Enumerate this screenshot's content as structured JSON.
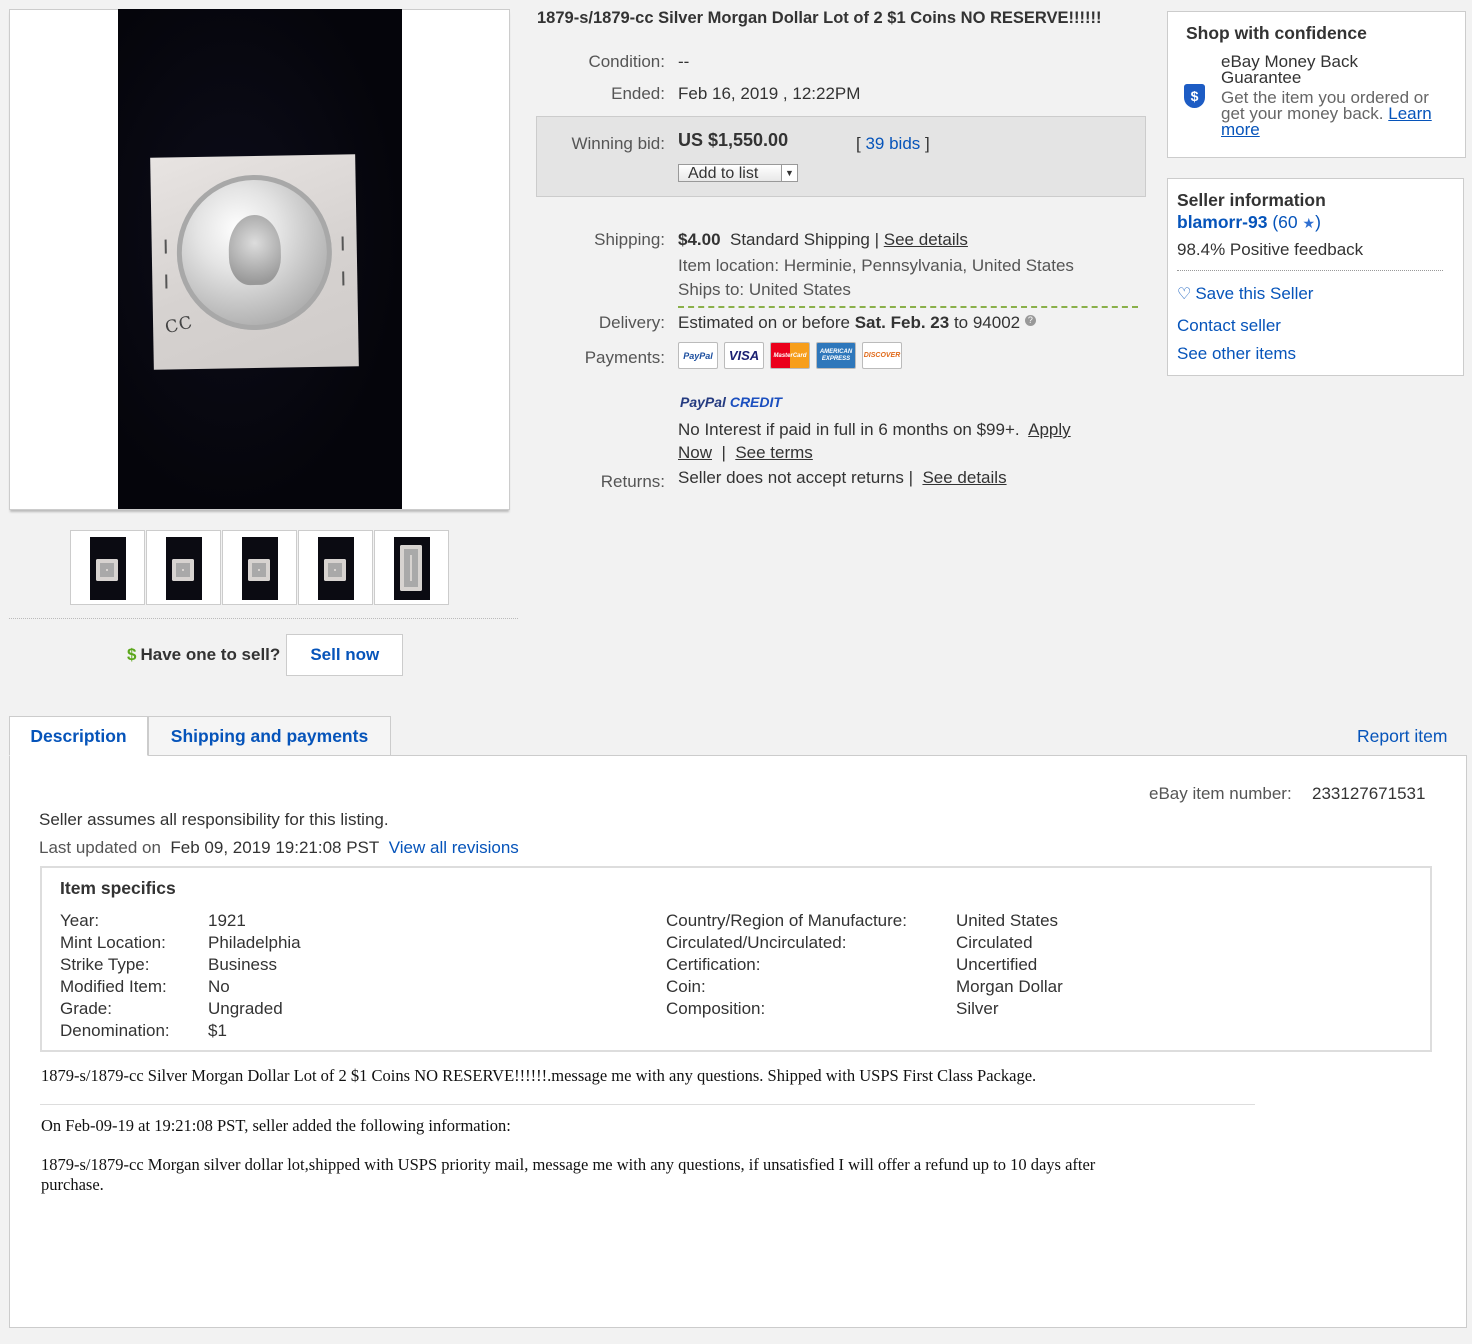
{
  "listing": {
    "title": "1879-s/1879-cc Silver Morgan Dollar Lot of 2 $1 Coins NO RESERVE!!!!!!",
    "condition_label": "Condition:",
    "condition_value": "--",
    "ended_label": "Ended:",
    "ended_value": "Feb 16, 2019 , 12:22PM",
    "winning_bid_label": "Winning bid:",
    "winning_bid_value": "US $1,550.00",
    "bids_open": "[",
    "bids_link": "39 bids",
    "bids_close": "]",
    "add_to_list": "Add to list",
    "shipping_label": "Shipping:",
    "shipping_price": "$4.00",
    "shipping_method": "Standard Shipping |",
    "shipping_see_details": "See details",
    "item_location": "Item location: Herminie, Pennsylvania, United States",
    "ships_to": "Ships to: United States",
    "delivery_label": "Delivery:",
    "delivery_prefix": "Estimated on or before",
    "delivery_date": "Sat. Feb. 23",
    "delivery_suffix": "to 94002",
    "payments_label": "Payments:",
    "cards": [
      "PayPal",
      "VISA",
      "MasterCard",
      "AMERICAN EXPRESS",
      "DISCOVER"
    ],
    "paypal_credit_pay": "PayPal",
    "paypal_credit_word": "CREDIT",
    "paypal_credit_text": "No Interest if paid in full in 6 months on $99+.",
    "apply_now_1": "Apply",
    "apply_now_2": "Now",
    "see_terms": "See terms",
    "returns_label": "Returns:",
    "returns_text": "Seller does not accept returns |",
    "returns_see_details": "See details"
  },
  "sell": {
    "dollar": "$",
    "question": "Have one to sell?",
    "button": "Sell now"
  },
  "confidence": {
    "title": "Shop with confidence",
    "guarantee_1": "eBay Money Back",
    "guarantee_2": "Guarantee",
    "text_1": "Get the item you ordered or",
    "text_2": "get your money back.",
    "learn_1": "Learn",
    "learn_2": "more"
  },
  "seller": {
    "title": "Seller information",
    "name": "blamorr-93",
    "score_open": "(",
    "score": "60",
    "score_close": ")",
    "feedback": "98.4% Positive feedback",
    "save": "Save this Seller",
    "contact": "Contact seller",
    "other_items": "See other items"
  },
  "tabs": {
    "description": "Description",
    "shipping": "Shipping and payments",
    "report": "Report item"
  },
  "description": {
    "item_number_label": "eBay item number:",
    "item_number": "233127671531",
    "responsibility": "Seller assumes all responsibility for this listing.",
    "last_updated_label": "Last updated on",
    "last_updated_value": "Feb 09, 2019 19:21:08 PST",
    "view_revisions": "View all revisions",
    "specifics_title": "Item specifics",
    "specifics_left": [
      {
        "k": "Year:",
        "v": "1921"
      },
      {
        "k": "Mint Location:",
        "v": "Philadelphia"
      },
      {
        "k": "Strike Type:",
        "v": "Business"
      },
      {
        "k": "Modified Item:",
        "v": "No"
      },
      {
        "k": "Grade:",
        "v": "Ungraded"
      },
      {
        "k": "Denomination:",
        "v": "$1"
      }
    ],
    "specifics_right": [
      {
        "k": "Country/Region of Manufacture:",
        "v": "United States"
      },
      {
        "k": "Circulated/Uncirculated:",
        "v": "Circulated"
      },
      {
        "k": "Certification:",
        "v": "Uncertified"
      },
      {
        "k": "Coin:",
        "v": "Morgan Dollar"
      },
      {
        "k": "Composition:",
        "v": "Silver"
      }
    ],
    "body_1": "1879-s/1879-cc Silver Morgan Dollar Lot of 2 $1 Coins NO RESERVE!!!!!!.message me with any questions. Shipped with USPS First Class Package.",
    "added_header": "On Feb-09-19 at 19:21:08 PST, seller added the following information:",
    "body_2a": "1879-s/1879-cc Morgan silver dollar lot,shipped with USPS priority mail, message me with any questions, if unsatisfied I will offer a refund up to 10 days after",
    "body_2b": "purchase."
  },
  "photo": {
    "holder_mark": "CC"
  },
  "colors": {
    "link": "#0654ba",
    "dollar_green": "#5ba71b",
    "delivery_dash": "#8ab04a"
  }
}
